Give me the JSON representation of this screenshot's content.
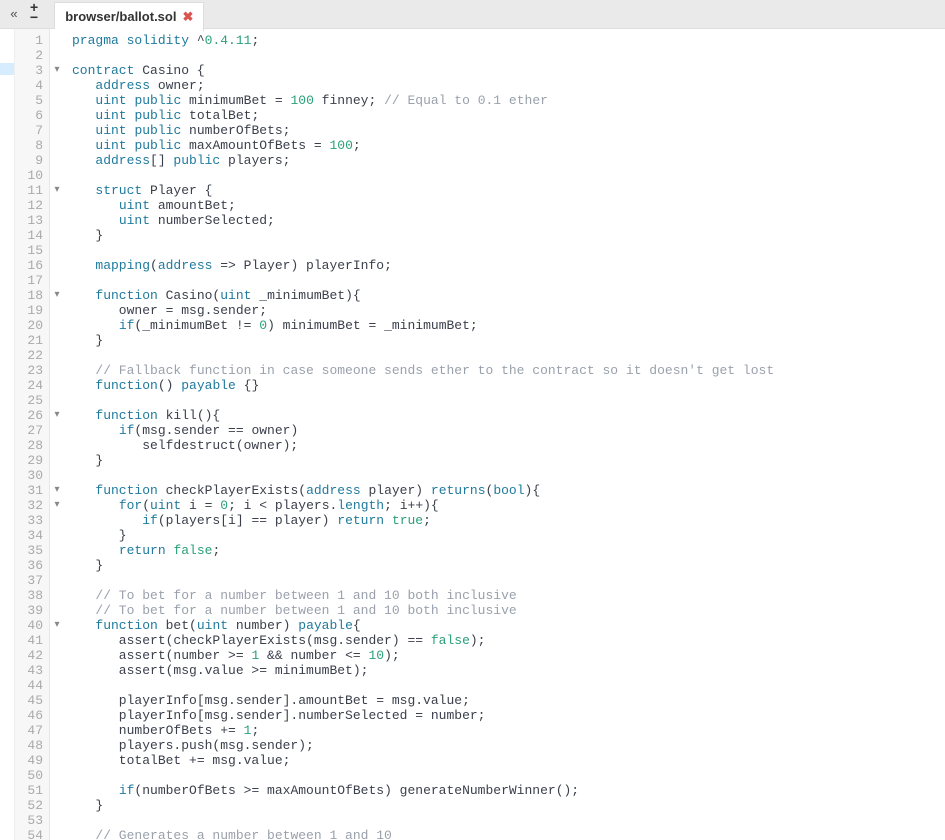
{
  "topbar": {
    "arrow": "«",
    "plus": "+",
    "minus": "−"
  },
  "tab": {
    "title": "browser/ballot.sol",
    "close": "✖"
  },
  "line_numbers": [
    "1",
    "2",
    "3",
    "4",
    "5",
    "6",
    "7",
    "8",
    "9",
    "10",
    "11",
    "12",
    "13",
    "14",
    "15",
    "16",
    "17",
    "18",
    "19",
    "20",
    "21",
    "22",
    "23",
    "24",
    "25",
    "26",
    "27",
    "28",
    "29",
    "30",
    "31",
    "32",
    "33",
    "34",
    "35",
    "36",
    "37",
    "38",
    "39",
    "40",
    "41",
    "42",
    "43",
    "44",
    "45",
    "46",
    "47",
    "48",
    "49",
    "50",
    "51",
    "52",
    "53",
    "54"
  ],
  "fold": {
    "3": "▾",
    "11": "▾",
    "18": "▾",
    "26": "▾",
    "31": "▾",
    "32": "▾",
    "40": "▾"
  },
  "code": [
    [
      {
        "t": "pragma solidity ",
        "c": "kw"
      },
      {
        "t": "^",
        "c": "op"
      },
      {
        "t": "0.4.11",
        "c": "num"
      },
      {
        "t": ";",
        "c": "op"
      }
    ],
    [],
    [
      {
        "t": "contract",
        "c": "kw"
      },
      {
        "t": " Casino {",
        "c": "ident"
      }
    ],
    [
      {
        "t": "   ",
        "c": "ident"
      },
      {
        "t": "address",
        "c": "type"
      },
      {
        "t": " owner;",
        "c": "ident"
      }
    ],
    [
      {
        "t": "   ",
        "c": "ident"
      },
      {
        "t": "uint",
        "c": "type"
      },
      {
        "t": " ",
        "c": "ident"
      },
      {
        "t": "public",
        "c": "kw"
      },
      {
        "t": " minimumBet = ",
        "c": "ident"
      },
      {
        "t": "100",
        "c": "num"
      },
      {
        "t": " finney; ",
        "c": "ident"
      },
      {
        "t": "// Equal to 0.1 ether",
        "c": "comm"
      }
    ],
    [
      {
        "t": "   ",
        "c": "ident"
      },
      {
        "t": "uint",
        "c": "type"
      },
      {
        "t": " ",
        "c": "ident"
      },
      {
        "t": "public",
        "c": "kw"
      },
      {
        "t": " totalBet;",
        "c": "ident"
      }
    ],
    [
      {
        "t": "   ",
        "c": "ident"
      },
      {
        "t": "uint",
        "c": "type"
      },
      {
        "t": " ",
        "c": "ident"
      },
      {
        "t": "public",
        "c": "kw"
      },
      {
        "t": " numberOfBets;",
        "c": "ident"
      }
    ],
    [
      {
        "t": "   ",
        "c": "ident"
      },
      {
        "t": "uint",
        "c": "type"
      },
      {
        "t": " ",
        "c": "ident"
      },
      {
        "t": "public",
        "c": "kw"
      },
      {
        "t": " maxAmountOfBets = ",
        "c": "ident"
      },
      {
        "t": "100",
        "c": "num"
      },
      {
        "t": ";",
        "c": "ident"
      }
    ],
    [
      {
        "t": "   ",
        "c": "ident"
      },
      {
        "t": "address",
        "c": "type"
      },
      {
        "t": "[] ",
        "c": "ident"
      },
      {
        "t": "public",
        "c": "kw"
      },
      {
        "t": " players;",
        "c": "ident"
      }
    ],
    [],
    [
      {
        "t": "   ",
        "c": "ident"
      },
      {
        "t": "struct",
        "c": "kw"
      },
      {
        "t": " Player {",
        "c": "ident"
      }
    ],
    [
      {
        "t": "      ",
        "c": "ident"
      },
      {
        "t": "uint",
        "c": "type"
      },
      {
        "t": " amountBet;",
        "c": "ident"
      }
    ],
    [
      {
        "t": "      ",
        "c": "ident"
      },
      {
        "t": "uint",
        "c": "type"
      },
      {
        "t": " numberSelected;",
        "c": "ident"
      }
    ],
    [
      {
        "t": "   }",
        "c": "ident"
      }
    ],
    [],
    [
      {
        "t": "   ",
        "c": "ident"
      },
      {
        "t": "mapping",
        "c": "kw"
      },
      {
        "t": "(",
        "c": "ident"
      },
      {
        "t": "address",
        "c": "type"
      },
      {
        "t": " => Player) playerInfo;",
        "c": "ident"
      }
    ],
    [],
    [
      {
        "t": "   ",
        "c": "ident"
      },
      {
        "t": "function",
        "c": "kw"
      },
      {
        "t": " Casino(",
        "c": "ident"
      },
      {
        "t": "uint",
        "c": "type"
      },
      {
        "t": " _minimumBet){",
        "c": "ident"
      }
    ],
    [
      {
        "t": "      owner = msg.sender;",
        "c": "ident"
      }
    ],
    [
      {
        "t": "      ",
        "c": "ident"
      },
      {
        "t": "if",
        "c": "kw"
      },
      {
        "t": "(_minimumBet != ",
        "c": "ident"
      },
      {
        "t": "0",
        "c": "num"
      },
      {
        "t": ") minimumBet = _minimumBet;",
        "c": "ident"
      }
    ],
    [
      {
        "t": "   }",
        "c": "ident"
      }
    ],
    [],
    [
      {
        "t": "   ",
        "c": "ident"
      },
      {
        "t": "// Fallback function in case someone sends ether to the contract so it doesn't get lost",
        "c": "comm"
      }
    ],
    [
      {
        "t": "   ",
        "c": "ident"
      },
      {
        "t": "function",
        "c": "kw"
      },
      {
        "t": "() ",
        "c": "ident"
      },
      {
        "t": "payable",
        "c": "kw"
      },
      {
        "t": " {}",
        "c": "ident"
      }
    ],
    [],
    [
      {
        "t": "   ",
        "c": "ident"
      },
      {
        "t": "function",
        "c": "kw"
      },
      {
        "t": " kill(){",
        "c": "ident"
      }
    ],
    [
      {
        "t": "      ",
        "c": "ident"
      },
      {
        "t": "if",
        "c": "kw"
      },
      {
        "t": "(msg.sender == owner)",
        "c": "ident"
      }
    ],
    [
      {
        "t": "         selfdestruct(owner);",
        "c": "ident"
      }
    ],
    [
      {
        "t": "   }",
        "c": "ident"
      }
    ],
    [],
    [
      {
        "t": "   ",
        "c": "ident"
      },
      {
        "t": "function",
        "c": "kw"
      },
      {
        "t": " checkPlayerExists(",
        "c": "ident"
      },
      {
        "t": "address",
        "c": "type"
      },
      {
        "t": " player) ",
        "c": "ident"
      },
      {
        "t": "returns",
        "c": "kw"
      },
      {
        "t": "(",
        "c": "ident"
      },
      {
        "t": "bool",
        "c": "type"
      },
      {
        "t": "){",
        "c": "ident"
      }
    ],
    [
      {
        "t": "      ",
        "c": "ident"
      },
      {
        "t": "for",
        "c": "kw"
      },
      {
        "t": "(",
        "c": "ident"
      },
      {
        "t": "uint",
        "c": "type"
      },
      {
        "t": " i = ",
        "c": "ident"
      },
      {
        "t": "0",
        "c": "num"
      },
      {
        "t": "; i < players.",
        "c": "ident"
      },
      {
        "t": "length",
        "c": "kw"
      },
      {
        "t": "; i++){",
        "c": "ident"
      }
    ],
    [
      {
        "t": "         ",
        "c": "ident"
      },
      {
        "t": "if",
        "c": "kw"
      },
      {
        "t": "(players[i] == player) ",
        "c": "ident"
      },
      {
        "t": "return",
        "c": "kw"
      },
      {
        "t": " ",
        "c": "ident"
      },
      {
        "t": "true",
        "c": "bool"
      },
      {
        "t": ";",
        "c": "ident"
      }
    ],
    [
      {
        "t": "      }",
        "c": "ident"
      }
    ],
    [
      {
        "t": "      ",
        "c": "ident"
      },
      {
        "t": "return",
        "c": "kw"
      },
      {
        "t": " ",
        "c": "ident"
      },
      {
        "t": "false",
        "c": "bool"
      },
      {
        "t": ";",
        "c": "ident"
      }
    ],
    [
      {
        "t": "   }",
        "c": "ident"
      }
    ],
    [],
    [
      {
        "t": "   ",
        "c": "ident"
      },
      {
        "t": "// To bet for a number between 1 and 10 both inclusive",
        "c": "comm"
      }
    ],
    [
      {
        "t": "   ",
        "c": "ident"
      },
      {
        "t": "// To bet for a number between 1 and 10 both inclusive",
        "c": "comm"
      }
    ],
    [
      {
        "t": "   ",
        "c": "ident"
      },
      {
        "t": "function",
        "c": "kw"
      },
      {
        "t": " bet(",
        "c": "ident"
      },
      {
        "t": "uint",
        "c": "type"
      },
      {
        "t": " number) ",
        "c": "ident"
      },
      {
        "t": "payable",
        "c": "kw"
      },
      {
        "t": "{",
        "c": "ident"
      }
    ],
    [
      {
        "t": "      assert(checkPlayerExists(msg.sender) == ",
        "c": "ident"
      },
      {
        "t": "false",
        "c": "bool"
      },
      {
        "t": ");",
        "c": "ident"
      }
    ],
    [
      {
        "t": "      assert(number >= ",
        "c": "ident"
      },
      {
        "t": "1",
        "c": "num"
      },
      {
        "t": " && number <= ",
        "c": "ident"
      },
      {
        "t": "10",
        "c": "num"
      },
      {
        "t": ");",
        "c": "ident"
      }
    ],
    [
      {
        "t": "      assert(msg.value >= minimumBet);",
        "c": "ident"
      }
    ],
    [],
    [
      {
        "t": "      playerInfo[msg.sender].amountBet = msg.value;",
        "c": "ident"
      }
    ],
    [
      {
        "t": "      playerInfo[msg.sender].numberSelected = number;",
        "c": "ident"
      }
    ],
    [
      {
        "t": "      numberOfBets += ",
        "c": "ident"
      },
      {
        "t": "1",
        "c": "num"
      },
      {
        "t": ";",
        "c": "ident"
      }
    ],
    [
      {
        "t": "      players.push(msg.sender);",
        "c": "ident"
      }
    ],
    [
      {
        "t": "      totalBet += msg.value;",
        "c": "ident"
      }
    ],
    [],
    [
      {
        "t": "      ",
        "c": "ident"
      },
      {
        "t": "if",
        "c": "kw"
      },
      {
        "t": "(numberOfBets >= maxAmountOfBets) generateNumberWinner();",
        "c": "ident"
      }
    ],
    [
      {
        "t": "   }",
        "c": "ident"
      }
    ],
    [],
    [
      {
        "t": "   ",
        "c": "ident"
      },
      {
        "t": "// Generates a number between 1 and 10",
        "c": "comm"
      }
    ]
  ]
}
